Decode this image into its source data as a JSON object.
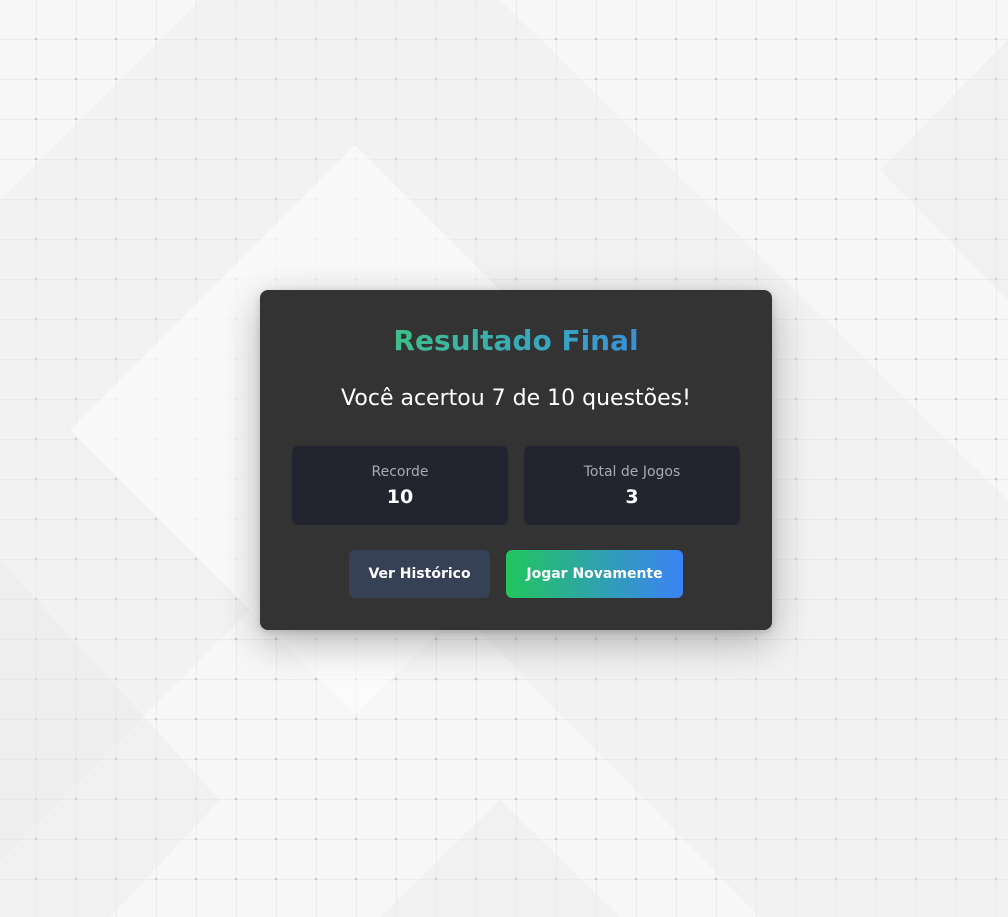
{
  "result": {
    "title": "Resultado Final",
    "score_text": "Você acertou 7 de 10 questões!"
  },
  "stats": [
    {
      "label": "Recorde",
      "value": "10"
    },
    {
      "label": "Total de Jogos",
      "value": "3"
    }
  ],
  "actions": {
    "history_label": "Ver Histórico",
    "play_again_label": "Jogar Novamente"
  },
  "colors": {
    "card_background": "#333333",
    "stat_background": "#22252f",
    "title_gradient_start": "#3fbf8a",
    "title_gradient_end": "#3b8fd6",
    "history_button": "#374156",
    "play_gradient_start": "#22c55e",
    "play_gradient_end": "#3b82f6"
  }
}
